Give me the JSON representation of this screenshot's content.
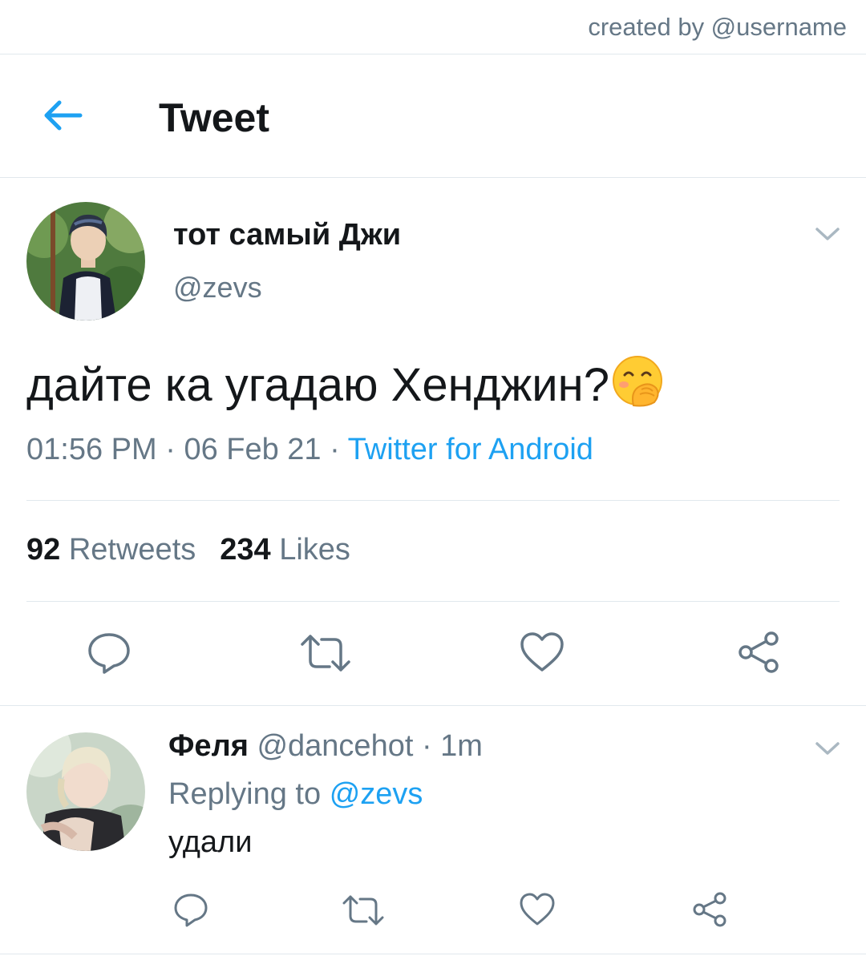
{
  "credit": "created by @username",
  "header": {
    "title": "Tweet"
  },
  "tweet": {
    "author_name": "тот самый Джи",
    "author_handle": "@zevs",
    "text": "дайте ка угадаю Хенджин?",
    "time": "01:56 PM",
    "date": "06 Feb 21",
    "source": "Twitter for Android",
    "separator": "·",
    "retweets_count": "92",
    "retweets_label": "Retweets",
    "likes_count": "234",
    "likes_label": "Likes"
  },
  "reply": {
    "author_name": "Феля",
    "author_handle": "@dancehot",
    "time": "1m",
    "separator": "·",
    "replying_prefix": "Replying to",
    "replying_handle": "@zevs",
    "text": "удали"
  },
  "icons": {
    "back": "back-arrow-icon",
    "chevron": "chevron-down-icon",
    "reply": "reply-icon",
    "retweet": "retweet-icon",
    "like": "heart-icon",
    "share": "share-icon",
    "emoji": "face-with-hand-over-mouth-emoji"
  },
  "colors": {
    "accent": "#1da1f2",
    "secondary_text": "#657786",
    "primary_text": "#14171a",
    "divider": "#e1e8ed"
  }
}
